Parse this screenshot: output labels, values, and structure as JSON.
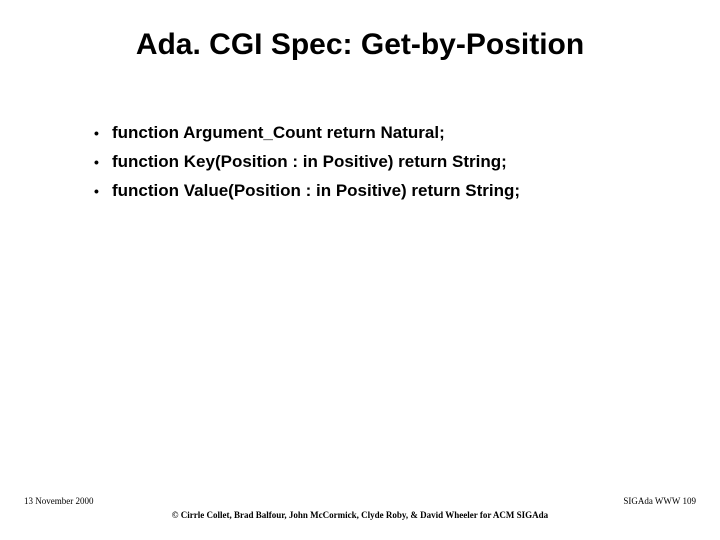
{
  "title": "Ada. CGI Spec: Get-by-Position",
  "bullets": [
    "function Argument_Count return Natural;",
    "function Key(Position : in Positive) return String;",
    "function Value(Position : in Positive) return String;"
  ],
  "footer": {
    "date": "13 November 2000",
    "credits": "© Cirrle Collet, Brad Balfour, John McCormick, Clyde Roby, & David Wheeler for ACM SIGAda",
    "right": "SIGAda WWW 109"
  }
}
